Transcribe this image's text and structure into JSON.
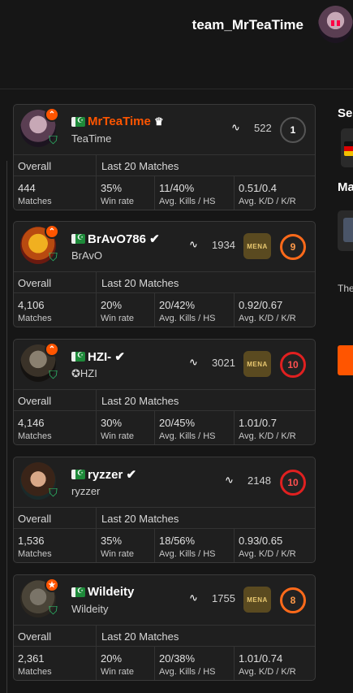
{
  "header": {
    "team_name": "team_MrTeaTime"
  },
  "table": {
    "overall_label": "Overall",
    "last20_label": "Last 20 Matches",
    "stat_labels": {
      "matches": "Matches",
      "winrate": "Win rate",
      "kills": "Avg. Kills / HS",
      "kd": "Avg. K/D / K/R"
    }
  },
  "players": [
    {
      "name": "MrTeaTime",
      "sub": "TeaTime",
      "elo": "522",
      "level": "1",
      "matches": "444",
      "winrate": "35%",
      "kills": "11/40%",
      "kd": "0.51/0.4",
      "crown": "♛"
    },
    {
      "name": "BrAvO786",
      "sub": "BrAvO",
      "elo": "1934",
      "level": "9",
      "rank": "MENA",
      "matches": "4,106",
      "winrate": "20%",
      "kills": "20/42%",
      "kd": "0.92/0.67"
    },
    {
      "name": "HZI-",
      "sub": "✪HZI",
      "elo": "3021",
      "level": "10",
      "rank": "MENA",
      "matches": "4,146",
      "winrate": "30%",
      "kills": "20/45%",
      "kd": "1.01/0.7"
    },
    {
      "name": "ryzzer",
      "sub": "ryzzer",
      "elo": "2148",
      "level": "10",
      "matches": "1,536",
      "winrate": "35%",
      "kills": "18/56%",
      "kd": "0.93/0.65"
    },
    {
      "name": "Wildeity",
      "sub": "Wildeity",
      "elo": "1755",
      "level": "8",
      "rank": "MENA",
      "matches": "2,361",
      "winrate": "20%",
      "kills": "20/38%",
      "kd": "1.01/0.74"
    }
  ],
  "right_panel": {
    "label1": "Se",
    "label2": "Ma",
    "text": "The"
  },
  "colors": {
    "accent": "#ff5500",
    "verified": "#ffffff",
    "shield": "#2ecc71",
    "level_red": "#e02020",
    "level_orange": "#ff6a1a"
  }
}
